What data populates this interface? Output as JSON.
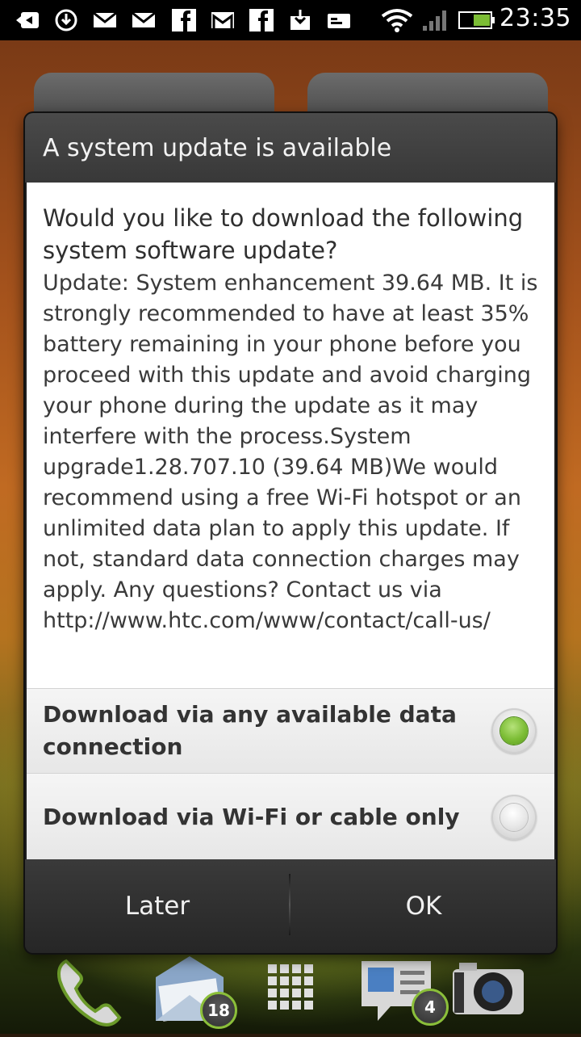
{
  "status_bar": {
    "time": "23:35",
    "icons": [
      "back-arrow-icon",
      "download-sync-icon",
      "gmail-icon",
      "mail-icon",
      "facebook-icon",
      "gmail-icon",
      "facebook-icon",
      "download-icon",
      "sd-card-icon",
      "wifi-icon",
      "signal-icon",
      "battery-icon"
    ]
  },
  "dialog": {
    "title": "A system update is available",
    "question": "Would you like to download the following system software update?",
    "details": "Update: System enhancement 39.64 MB. It is strongly recommended to have at least 35% battery remaining in your phone before you proceed with this update and avoid charging your phone during the update as it may interfere with the process.System upgrade1.28.707.10 (39.64 MB)We would recommend using a free Wi-Fi hotspot or an unlimited data plan to apply this update. If not, standard data connection charges may apply. Any questions? Contact us via http://www.htc.com/www/contact/call-us/",
    "options": [
      {
        "label": "Download via any available data connection",
        "selected": true
      },
      {
        "label": "Download via Wi-Fi or cable only",
        "selected": false
      }
    ],
    "buttons": {
      "later": "Later",
      "ok": "OK"
    },
    "accent_color": "#7cbd35"
  },
  "dock": {
    "items": [
      "phone-icon",
      "mail-icon",
      "app-drawer-icon",
      "messages-icon",
      "camera-icon"
    ],
    "mail_badge": "18",
    "messages_badge": "4"
  }
}
